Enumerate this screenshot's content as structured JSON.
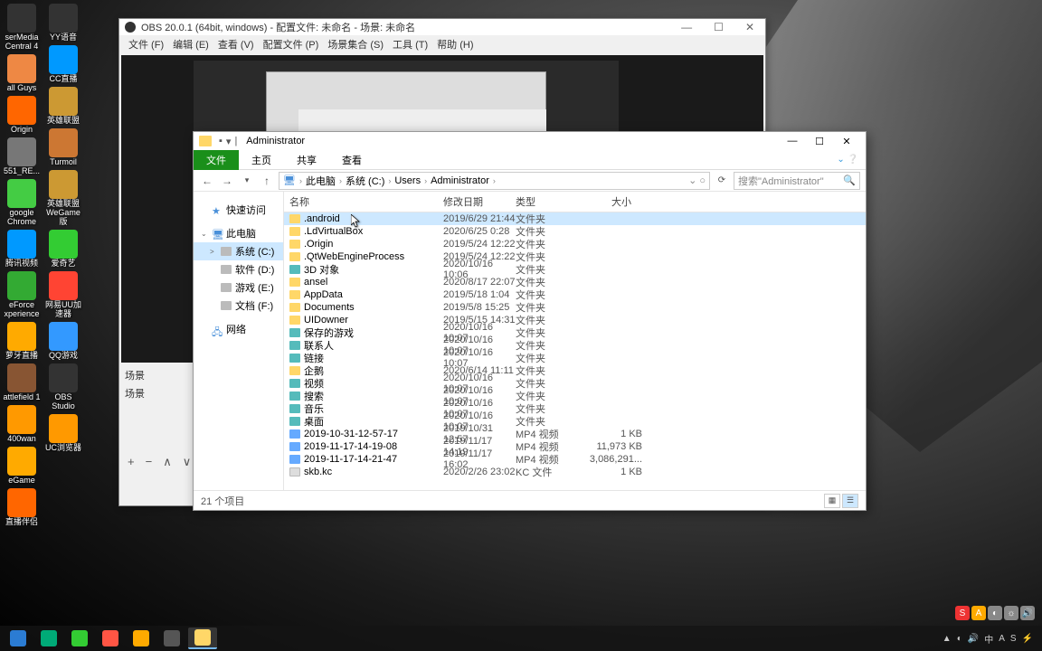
{
  "desktop": {
    "icons_col1": [
      {
        "label": "serMedia Central 4",
        "color": "#333"
      },
      {
        "label": "all Guys",
        "color": "#e84"
      },
      {
        "label": "Origin",
        "color": "#f60"
      },
      {
        "label": "551_RE...",
        "color": "#777"
      },
      {
        "label": "google Chrome",
        "color": "#4c4"
      },
      {
        "label": "腾讯视频",
        "color": "#09f"
      },
      {
        "label": "eForce xperience",
        "color": "#3a3"
      },
      {
        "label": "萝牙直播",
        "color": "#fa0"
      },
      {
        "label": "attlefield 1",
        "color": "#853"
      },
      {
        "label": "400wan",
        "color": "#f90"
      },
      {
        "label": "eGame",
        "color": "#fa0"
      },
      {
        "label": "直播伴侣",
        "color": "#f60"
      }
    ],
    "icons_col2": [
      {
        "label": "YY语音",
        "color": "#333"
      },
      {
        "label": "CC直播",
        "color": "#09f"
      },
      {
        "label": "英雄联盟",
        "color": "#c93"
      },
      {
        "label": "Turmoil",
        "color": "#c73"
      },
      {
        "label": "英雄联盟 WeGame版",
        "color": "#c93"
      },
      {
        "label": "爱奇艺",
        "color": "#3c3"
      },
      {
        "label": "网易UU加速器",
        "color": "#f43"
      },
      {
        "label": "QQ游戏",
        "color": "#39f"
      },
      {
        "label": "OBS Studio",
        "color": "#333"
      },
      {
        "label": "UC浏览器",
        "color": "#f90"
      }
    ]
  },
  "obs": {
    "title": "OBS 20.0.1 (64bit, windows) - 配置文件: 未命名 - 场景: 未命名",
    "menu": [
      "文件 (F)",
      "编辑 (E)",
      "查看 (V)",
      "配置文件 (P)",
      "场景集合 (S)",
      "工具 (T)",
      "帮助 (H)"
    ],
    "panel1": "场景",
    "panel2": "场景",
    "btns": [
      "+",
      "−",
      "∧",
      "∨"
    ]
  },
  "explorer": {
    "title": "Administrator",
    "tabs": {
      "file": "文件",
      "home": "主页",
      "share": "共享",
      "view": "查看"
    },
    "breadcrumb": [
      "此电脑",
      "系统 (C:)",
      "Users",
      "Administrator"
    ],
    "search_placeholder": "搜索\"Administrator\"",
    "nav": {
      "quick": "快速访问",
      "pc": "此电脑",
      "drives": [
        "系统 (C:)",
        "软件 (D:)",
        "游戏 (E:)",
        "文档 (F:)"
      ],
      "network": "网络"
    },
    "columns": {
      "name": "名称",
      "date": "修改日期",
      "type": "类型",
      "size": "大小"
    },
    "files": [
      {
        "icon": "folder",
        "name": ".android",
        "date": "2019/6/29 21:44",
        "type": "文件夹",
        "size": "",
        "sel": true
      },
      {
        "icon": "folder",
        "name": ".LdVirtualBox",
        "date": "2020/6/25 0:28",
        "type": "文件夹",
        "size": ""
      },
      {
        "icon": "folder",
        "name": ".Origin",
        "date": "2019/5/24 12:22",
        "type": "文件夹",
        "size": ""
      },
      {
        "icon": "folder",
        "name": ".QtWebEngineProcess",
        "date": "2019/5/24 12:22",
        "type": "文件夹",
        "size": ""
      },
      {
        "icon": "obj",
        "name": "3D 对象",
        "date": "2020/10/16 10:06",
        "type": "文件夹",
        "size": ""
      },
      {
        "icon": "folder",
        "name": "ansel",
        "date": "2020/8/17 22:07",
        "type": "文件夹",
        "size": ""
      },
      {
        "icon": "folder",
        "name": "AppData",
        "date": "2019/5/18 1:04",
        "type": "文件夹",
        "size": ""
      },
      {
        "icon": "folder",
        "name": "Documents",
        "date": "2019/5/8 15:25",
        "type": "文件夹",
        "size": ""
      },
      {
        "icon": "folder",
        "name": "UIDowner",
        "date": "2019/5/15 14:31",
        "type": "文件夹",
        "size": ""
      },
      {
        "icon": "obj",
        "name": "保存的游戏",
        "date": "2020/10/16 10:07",
        "type": "文件夹",
        "size": ""
      },
      {
        "icon": "obj",
        "name": "联系人",
        "date": "2020/10/16 10:07",
        "type": "文件夹",
        "size": ""
      },
      {
        "icon": "obj",
        "name": "链接",
        "date": "2020/10/16 10:07",
        "type": "文件夹",
        "size": ""
      },
      {
        "icon": "folder",
        "name": "企鹅",
        "date": "2020/6/14 11:11",
        "type": "文件夹",
        "size": ""
      },
      {
        "icon": "obj",
        "name": "视频",
        "date": "2020/10/16 10:07",
        "type": "文件夹",
        "size": ""
      },
      {
        "icon": "obj",
        "name": "搜索",
        "date": "2020/10/16 10:07",
        "type": "文件夹",
        "size": ""
      },
      {
        "icon": "obj",
        "name": "音乐",
        "date": "2020/10/16 10:07",
        "type": "文件夹",
        "size": ""
      },
      {
        "icon": "obj",
        "name": "桌面",
        "date": "2020/10/16 10:07",
        "type": "文件夹",
        "size": ""
      },
      {
        "icon": "vid",
        "name": "2019-10-31-12-57-17",
        "date": "2019/10/31 12:57",
        "type": "MP4 视频",
        "size": "1 KB"
      },
      {
        "icon": "vid",
        "name": "2019-11-17-14-19-08",
        "date": "2019/11/17 14:19",
        "type": "MP4 视频",
        "size": "11,973 KB"
      },
      {
        "icon": "vid",
        "name": "2019-11-17-14-21-47",
        "date": "2019/11/17 16:02",
        "type": "MP4 视频",
        "size": "3,086,291..."
      },
      {
        "icon": "file",
        "name": "skb.kc",
        "date": "2020/2/26 23:02",
        "type": "KC 文件",
        "size": "1 KB"
      }
    ],
    "status": "21 个项目"
  },
  "taskbar": {
    "items": [
      {
        "name": "ie",
        "color": "#2b7cd3"
      },
      {
        "name": "edge",
        "color": "#0a7"
      },
      {
        "name": "media",
        "color": "#3c3"
      },
      {
        "name": "obs",
        "color": "#f54"
      },
      {
        "name": "g",
        "color": "#fa0"
      },
      {
        "name": "rec",
        "color": "#555"
      },
      {
        "name": "explorer",
        "color": "#ffd768",
        "active": true
      }
    ],
    "tray": [
      "▲",
      "◐",
      "🔊",
      "中",
      "A",
      "S",
      "⚡"
    ]
  },
  "badges": [
    "S",
    "A",
    "◐",
    "☼",
    "🔊"
  ]
}
